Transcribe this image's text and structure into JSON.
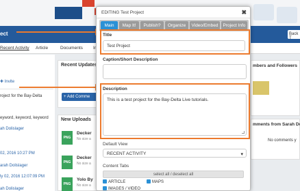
{
  "background": {
    "header": {
      "project_text": "ect",
      "back_button": "Back T"
    },
    "nav": [
      "Recent Activity",
      "Article",
      "Documents",
      "In"
    ],
    "left_panel": {
      "invite": "Invite",
      "lines": [
        "roject for the Bay-Delta",
        "eyword, keyword, keyword",
        "ah Dolislager",
        "02, 2016 10:27 PM",
        "arah Dolislager",
        "ly 02, 2016 12:07:09 PM",
        "ah Dolislager"
      ]
    },
    "middle_panel": {
      "recent_updates": "Recent Updates",
      "add_comment": "+ Add Comme",
      "new_uploads": "New Uploads",
      "uploads": [
        {
          "name": "Decker",
          "size": "No size a",
          "type": "PNG"
        },
        {
          "name": "Decker",
          "size": "No size a",
          "type": "PNG"
        },
        {
          "name": "Yolo By",
          "size": "No size a",
          "type": "PNG"
        }
      ]
    },
    "right_panel": {
      "members": "mbers and Followers",
      "comments": "mments from Sarah Do",
      "no_comments": "No comments y"
    }
  },
  "modal": {
    "title": "EDITING Test Project",
    "close": "✖",
    "tabs": [
      "Main",
      "Map It!",
      "Publish?",
      "Organize",
      "Video/Embed",
      "Project Info"
    ],
    "active_tab": 0,
    "fields": {
      "title_label": "Title",
      "title_value": "Test Project",
      "caption_label": "Caption/Short Description",
      "caption_value": "",
      "description_label": "Description",
      "description_value": "This is a test project for the Bay-Delta Live tutorials.",
      "default_view_label": "Default View",
      "default_view_value": "RECENT ACTIVITY",
      "content_tabs_label": "Content Tabs",
      "select_all": "select all / deselect all",
      "checkboxes": [
        "ARTICLE",
        "MAPS",
        "IMAGES / VIDEO"
      ]
    }
  },
  "colors": {
    "accent": "#ec7a2d",
    "tab_active": "#2b91d6",
    "header": "#245a9b"
  }
}
